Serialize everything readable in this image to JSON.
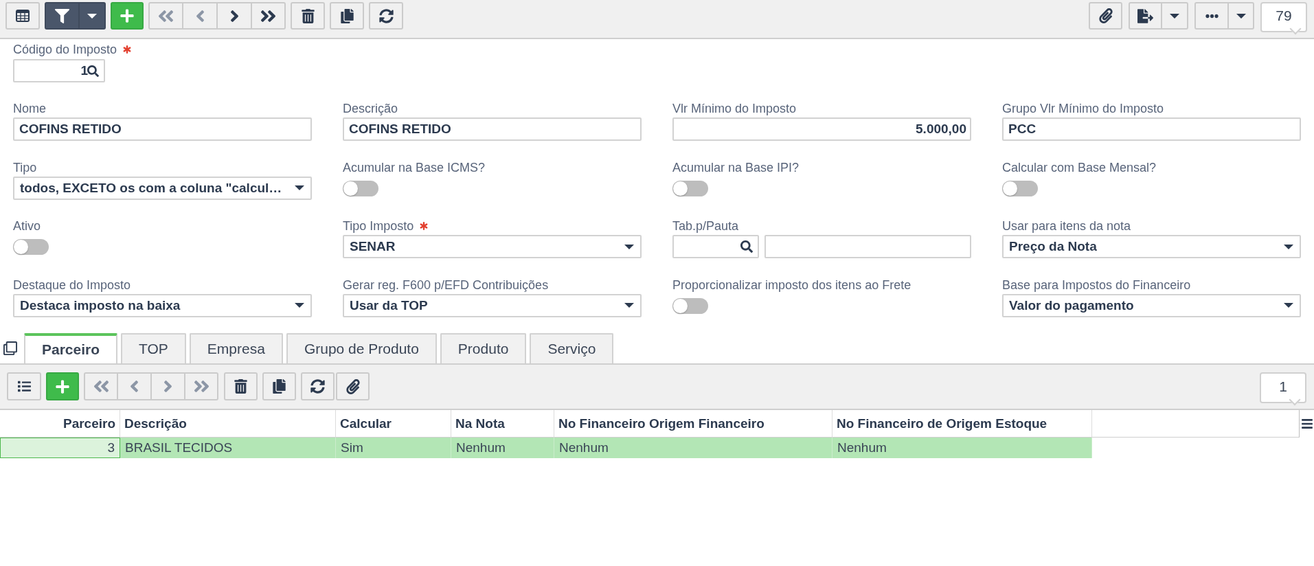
{
  "toolbar": {
    "filter_active": true,
    "navigation": [
      {
        "kind": "first",
        "disabled": true
      },
      {
        "kind": "previous",
        "disabled": true
      },
      {
        "kind": "next",
        "disabled": false
      },
      {
        "kind": "last",
        "disabled": false
      }
    ],
    "record_count": "79"
  },
  "code_field": {
    "label": "Código do Imposto",
    "required": true,
    "lookup_mark": "1"
  },
  "fields": [
    {
      "kind": "text",
      "label": "Nome",
      "required": false,
      "value": "COFINS RETIDO"
    },
    {
      "kind": "text",
      "label": "Descrição",
      "required": false,
      "value": "COFINS RETIDO"
    },
    {
      "kind": "number",
      "label": "Vlr Mínimo do Imposto",
      "required": false,
      "value": "5.000,00"
    },
    {
      "kind": "text",
      "label": "Grupo Vlr Mínimo do Imposto",
      "required": false,
      "value": "PCC"
    },
    {
      "kind": "select",
      "label": "Tipo",
      "required": false,
      "value": "todos, EXCETO os com a coluna \"calcul…"
    },
    {
      "kind": "toggle",
      "label": "Acumular na Base ICMS?",
      "required": false,
      "on": false
    },
    {
      "kind": "toggle",
      "label": "Acumular na Base IPI?",
      "required": false,
      "on": false
    },
    {
      "kind": "toggle",
      "label": "Calcular com Base Mensal?",
      "required": false,
      "on": false
    },
    {
      "kind": "toggle",
      "label": "Ativo",
      "required": false,
      "on": false
    },
    {
      "kind": "select",
      "label": "Tipo Imposto",
      "required": true,
      "value": "SENAR"
    },
    {
      "kind": "lookup_pair",
      "label": "Tab.p/Pauta",
      "required": false
    },
    {
      "kind": "select",
      "label": "Usar para itens da nota",
      "required": false,
      "value": "Preço da Nota"
    },
    {
      "kind": "select",
      "label": "Destaque do Imposto",
      "required": false,
      "value": "Destaca imposto na baixa"
    },
    {
      "kind": "select",
      "label": "Gerar reg. F600 p/EFD Contribuições",
      "required": false,
      "value": "Usar da TOP"
    },
    {
      "kind": "toggle",
      "label": "Proporcionalizar imposto dos itens ao Frete",
      "required": false,
      "on": false
    },
    {
      "kind": "select",
      "label": "Base para Impostos do Financeiro",
      "required": false,
      "value": "Valor do pagamento"
    }
  ],
  "tabs": [
    {
      "label": "Parceiro",
      "selected": true
    },
    {
      "label": "TOP",
      "selected": false
    },
    {
      "label": "Empresa",
      "selected": false
    },
    {
      "label": "Grupo de Produto",
      "selected": false
    },
    {
      "label": "Produto",
      "selected": false
    },
    {
      "label": "Serviço",
      "selected": false
    }
  ],
  "detail_toolbar": {
    "navigation": [
      {
        "kind": "first",
        "disabled": true
      },
      {
        "kind": "previous",
        "disabled": true
      },
      {
        "kind": "next",
        "disabled": true
      },
      {
        "kind": "last",
        "disabled": true
      }
    ],
    "record_count": "1"
  },
  "grid": {
    "columns": [
      {
        "label": "Parceiro",
        "kind": "number"
      },
      {
        "label": "Descrição",
        "kind": "text"
      },
      {
        "label": "Calcular",
        "kind": "text"
      },
      {
        "label": "Na Nota",
        "kind": "text"
      },
      {
        "label": "No Financeiro Origem Financeiro",
        "kind": "text"
      },
      {
        "label": "No Financeiro de Origem Estoque",
        "kind": "text"
      }
    ],
    "rows": [
      {
        "selected": true,
        "cells": [
          {
            "text": "3",
            "focused": true
          },
          {
            "text": "BRASIL TECIDOS",
            "focused": false
          },
          {
            "text": "Sim",
            "focused": false
          },
          {
            "text": "Nenhum",
            "focused": false
          },
          {
            "text": "Nenhum",
            "focused": false
          },
          {
            "text": "Nenhum",
            "focused": false
          }
        ]
      }
    ]
  }
}
